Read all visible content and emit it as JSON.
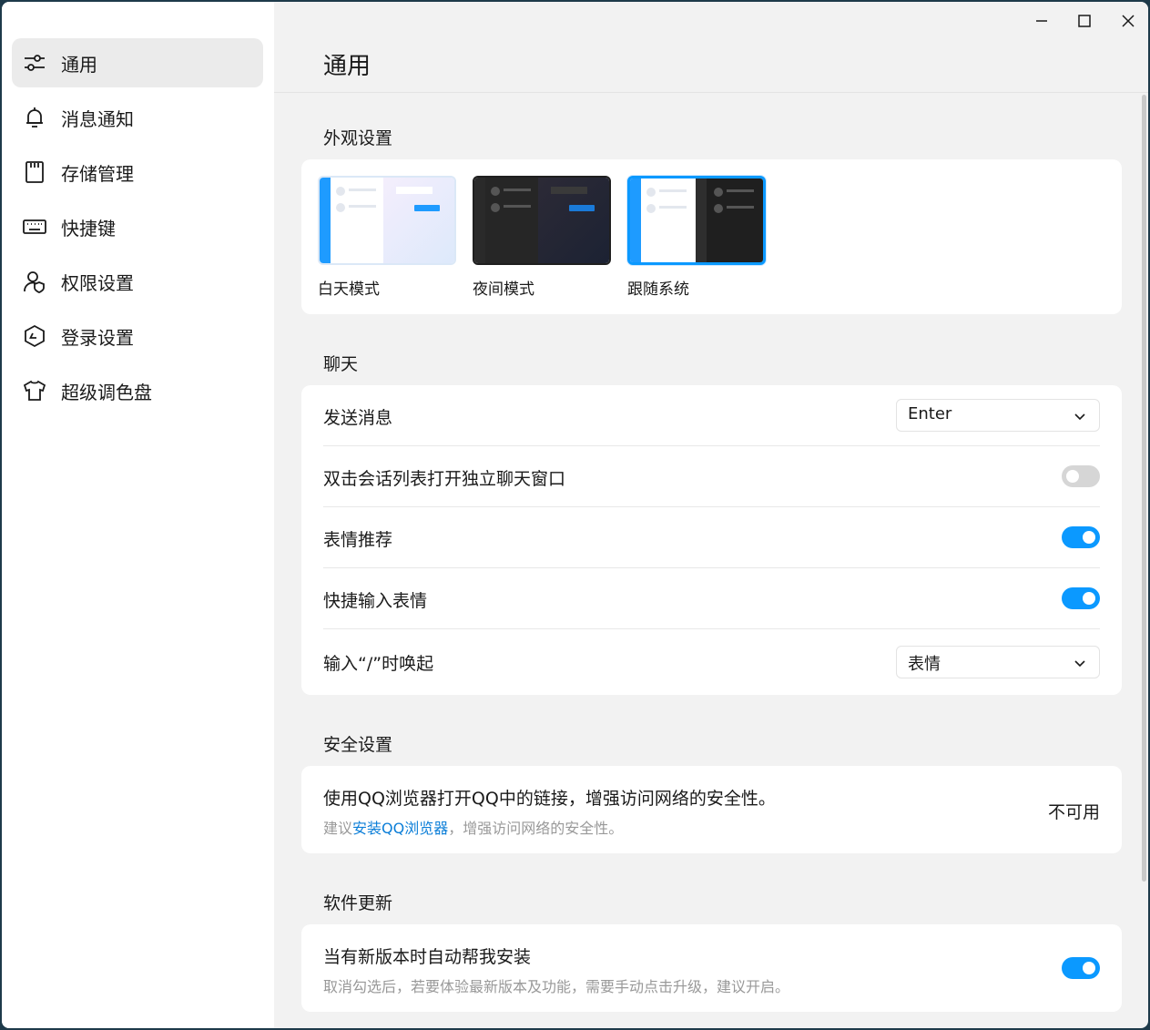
{
  "window": {
    "minimize_icon": "minimize-icon",
    "maximize_icon": "maximize-icon",
    "close_icon": "close-icon"
  },
  "sidebar": {
    "items": [
      {
        "label": "通用",
        "icon": "sliders-icon",
        "active": true
      },
      {
        "label": "消息通知",
        "icon": "bell-icon"
      },
      {
        "label": "存储管理",
        "icon": "sd-card-icon"
      },
      {
        "label": "快捷键",
        "icon": "keyboard-icon"
      },
      {
        "label": "权限设置",
        "icon": "user-shield-icon"
      },
      {
        "label": "登录设置",
        "icon": "hexagon-check-icon"
      },
      {
        "label": "超级调色盘",
        "icon": "tshirt-icon"
      }
    ]
  },
  "page": {
    "title": "通用"
  },
  "appearance": {
    "title": "外观设置",
    "themes": [
      {
        "label": "白天模式"
      },
      {
        "label": "夜间模式"
      },
      {
        "label": "跟随系统",
        "selected": true
      }
    ]
  },
  "chat": {
    "title": "聊天",
    "send_message": {
      "label": "发送消息",
      "value": "Enter"
    },
    "double_click_open": {
      "label": "双击会话列表打开独立聊天窗口",
      "enabled": false
    },
    "emoji_recommend": {
      "label": "表情推荐",
      "enabled": true
    },
    "quick_emoji_input": {
      "label": "快捷输入表情",
      "enabled": true
    },
    "slash_invoke": {
      "label": "输入“/”时唤起",
      "value": "表情"
    }
  },
  "security": {
    "title": "安全设置",
    "main_text": "使用QQ浏览器打开QQ中的链接，增强访问网络的安全性。",
    "sub_prefix": "建议",
    "sub_link": "安装QQ浏览器",
    "sub_suffix": "，增强访问网络的安全性。",
    "status": "不可用"
  },
  "update": {
    "title": "软件更新",
    "auto_install": {
      "label": "当有新版本时自动帮我安装",
      "enabled": true
    },
    "sub": "取消勾选后，若要体验最新版本及功能，需要手动点击升级，建议开启。"
  },
  "colors": {
    "accent": "#0b99ff",
    "link": "#0b7ed8"
  }
}
